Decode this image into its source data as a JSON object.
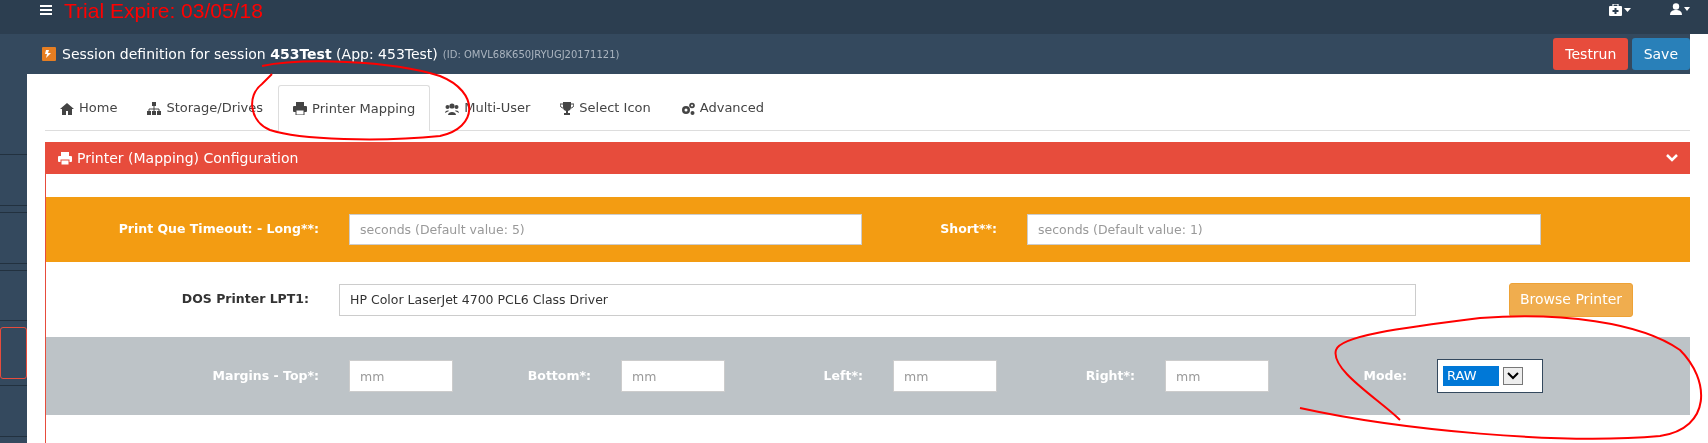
{
  "topbar": {
    "title": "Trial Expire: 03/05/18"
  },
  "sidebar": {
    "items": [
      {
        "selected": false
      },
      {
        "selected": false
      },
      {
        "selected": false
      },
      {
        "selected": true
      },
      {
        "selected": false
      }
    ]
  },
  "header": {
    "title": "Session definition for session **453Test** (App: 453Test)",
    "id": "(ID: OMVL68K650JRYUGJ20171121)",
    "buttons": [
      {
        "label": "Testrun",
        "kind": "danger"
      },
      {
        "label": "Save",
        "kind": "primary"
      }
    ]
  },
  "tabs": [
    {
      "label": "Home",
      "selected": false
    },
    {
      "label": "Storage/Drives",
      "selected": false
    },
    {
      "label": "Printer Mapping",
      "selected": true
    },
    {
      "label": "Multi-User",
      "selected": false
    },
    {
      "label": "Select Icon",
      "selected": false
    },
    {
      "label": "Advanced",
      "selected": false
    }
  ],
  "panel": {
    "title": "Printer (Mapping) Configuration",
    "timeout_row": {
      "fields": [
        {
          "label": "Print Que Timeout: - Long**:",
          "placeholder": "seconds (Default value: 5)"
        },
        {
          "label": "Short**:",
          "placeholder": "seconds (Default value: 1)"
        }
      ]
    },
    "printer_row": {
      "label": "DOS Printer LPT1:",
      "value": "HP Color LaserJet 4700 PCL6 Class Driver",
      "button": "Browse Printer"
    },
    "margins_row": {
      "fields": [
        {
          "label": "Margins - Top*:",
          "placeholder": "mm"
        },
        {
          "label": "Bottom*:",
          "placeholder": "mm"
        },
        {
          "label": "Left*:",
          "placeholder": "mm"
        },
        {
          "label": "Right*:",
          "placeholder": "mm"
        }
      ],
      "mode": {
        "label": "Mode:",
        "value": "RAW"
      }
    }
  }
}
